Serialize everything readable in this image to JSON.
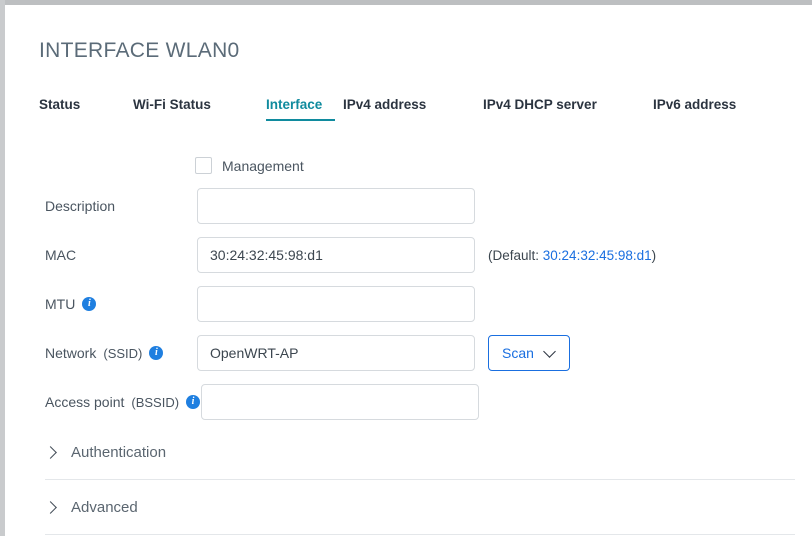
{
  "header": {
    "title": "INTERFACE WLAN0"
  },
  "tabs": {
    "items": [
      {
        "label": "Status",
        "active": false
      },
      {
        "label": "Wi-Fi Status",
        "active": false
      },
      {
        "label": "Interface",
        "active": true
      },
      {
        "label": "IPv4 address",
        "active": false
      },
      {
        "label": "IPv4 DHCP server",
        "active": false
      },
      {
        "label": "IPv6 address",
        "active": false
      }
    ],
    "active_color": "#108b9e"
  },
  "form": {
    "management": {
      "label": "Management",
      "checked": false
    },
    "description": {
      "label": "Description",
      "value": "",
      "placeholder": ""
    },
    "mac": {
      "label": "MAC",
      "value": "30:24:32:45:98:d1",
      "default_prefix": "(Default: ",
      "default_value": "30:24:32:45:98:d1",
      "default_suffix": ")",
      "link_color": "#1a6fe0"
    },
    "mtu": {
      "label": "MTU",
      "value": "",
      "info_icon": "info-icon"
    },
    "ssid": {
      "label": "Network",
      "sub_label": "(SSID)",
      "value": "OpenWRT-AP",
      "info_icon": "info-icon",
      "scan_button": "Scan",
      "scan_icon": "chevron-down-icon"
    },
    "bssid": {
      "label": "Access point",
      "sub_label": "(BSSID)",
      "value": "",
      "info_icon": "info-icon"
    }
  },
  "sections": [
    {
      "label": "Authentication",
      "icon": "chevron-right-icon",
      "expanded": false
    },
    {
      "label": "Advanced",
      "icon": "chevron-right-icon",
      "expanded": false
    }
  ]
}
